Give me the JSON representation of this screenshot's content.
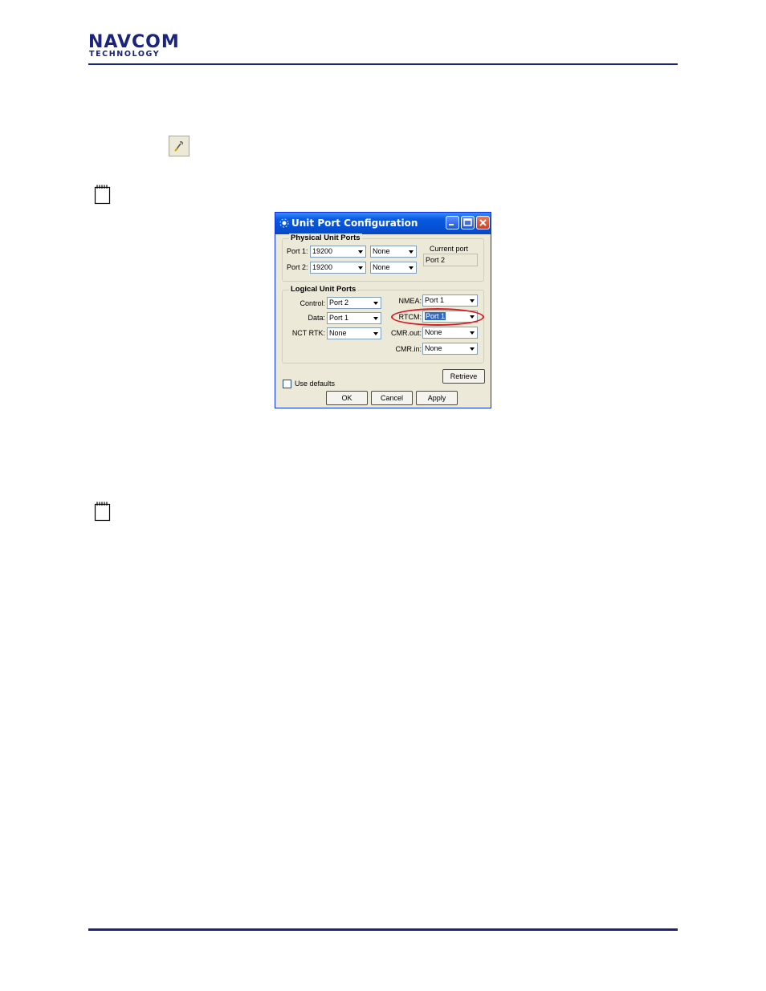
{
  "header": {
    "logo_line1": "NAVCOM",
    "logo_line2": "TECHNOLOGY"
  },
  "icons": {
    "toolbar_icon": "wrench-port-icon",
    "note_icon": "notepad-icon"
  },
  "dialog": {
    "title": "Unit Port Configuration",
    "physical": {
      "legend": "Physical  Unit Ports",
      "port1_label": "Port 1:",
      "port1_baud": "19200",
      "port1_mode": "None",
      "port2_label": "Port 2:",
      "port2_baud": "19200",
      "port2_mode": "None",
      "current_port_label": "Current port",
      "current_port_value": "Port 2"
    },
    "logical": {
      "legend": "Logical Unit Ports",
      "control_label": "Control:",
      "control_value": "Port 2",
      "data_label": "Data:",
      "data_value": "Port 1",
      "nctrtk_label": "NCT RTK:",
      "nctrtk_value": "None",
      "nmea_label": "NMEA:",
      "nmea_value": "Port 1",
      "rtcm_label": "RTCM:",
      "rtcm_value": "Port 1",
      "cmrout_label": "CMR.out:",
      "cmrout_value": "None",
      "cmrin_label": "CMR.in:",
      "cmrin_value": "None"
    },
    "use_defaults_label": "Use defaults",
    "retrieve_label": "Retrieve",
    "ok_label": "OK",
    "cancel_label": "Cancel",
    "apply_label": "Apply",
    "colors": {
      "titlebar": "#0551d6",
      "highlight_oval": "#d71920",
      "selection": "#316ac5"
    }
  }
}
